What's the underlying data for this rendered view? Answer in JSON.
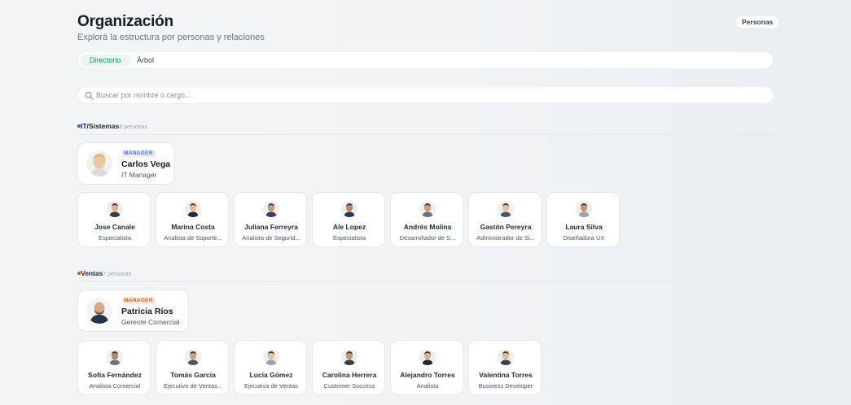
{
  "header": {
    "title": "Organización",
    "subtitle": "Explorá la estructura por personas y relaciones",
    "view_button": "Personas"
  },
  "tabs": [
    {
      "label": "Directorio",
      "active": true
    },
    {
      "label": "Árbol",
      "active": false
    }
  ],
  "search": {
    "placeholder": "Buscar por nombre o cargo...",
    "value": ""
  },
  "groups": [
    {
      "name": "IT/Sistemas",
      "count_label": "8 personas",
      "dot_color": "#3b5bdb",
      "manager": {
        "badge": "MANAGER",
        "name": "Carlos Vega",
        "role": "IT Manager",
        "badge_bg": "#e7ecfb",
        "badge_color": "#4c6ef5"
      },
      "members": [
        {
          "name": "Jose Canale",
          "role": "Especialista"
        },
        {
          "name": "Marina Costa",
          "role": "Analista de Soporte..."
        },
        {
          "name": "Juliana Ferreyra",
          "role": "Analista de Segurid..."
        },
        {
          "name": "Ale Lopez",
          "role": "Especialista"
        },
        {
          "name": "Andrés Molina",
          "role": "Desarrollador de S..."
        },
        {
          "name": "Gastón Pereyra",
          "role": "Administrador de Si..."
        },
        {
          "name": "Laura Silva",
          "role": "Diseñadora UX"
        }
      ]
    },
    {
      "name": "Ventas",
      "count_label": "7 personas",
      "dot_color": "#e8590c",
      "manager": {
        "badge": "MANAGER",
        "name": "Patricia Ríos",
        "role": "Gerente Comercial",
        "badge_bg": "#fdf0e6",
        "badge_color": "#e8590c"
      },
      "members": [
        {
          "name": "Sofía Fernández",
          "role": "Analista Comercial"
        },
        {
          "name": "Tomás García",
          "role": "Ejecutivo de Ventas..."
        },
        {
          "name": "Lucía Gómez",
          "role": "Ejecutiva de Ventas"
        },
        {
          "name": "Carolina Herrera",
          "role": "Customer Success"
        },
        {
          "name": "Alejandro Torres",
          "role": "Analista"
        },
        {
          "name": "Valentina Torres",
          "role": "Business Developer"
        }
      ]
    }
  ]
}
